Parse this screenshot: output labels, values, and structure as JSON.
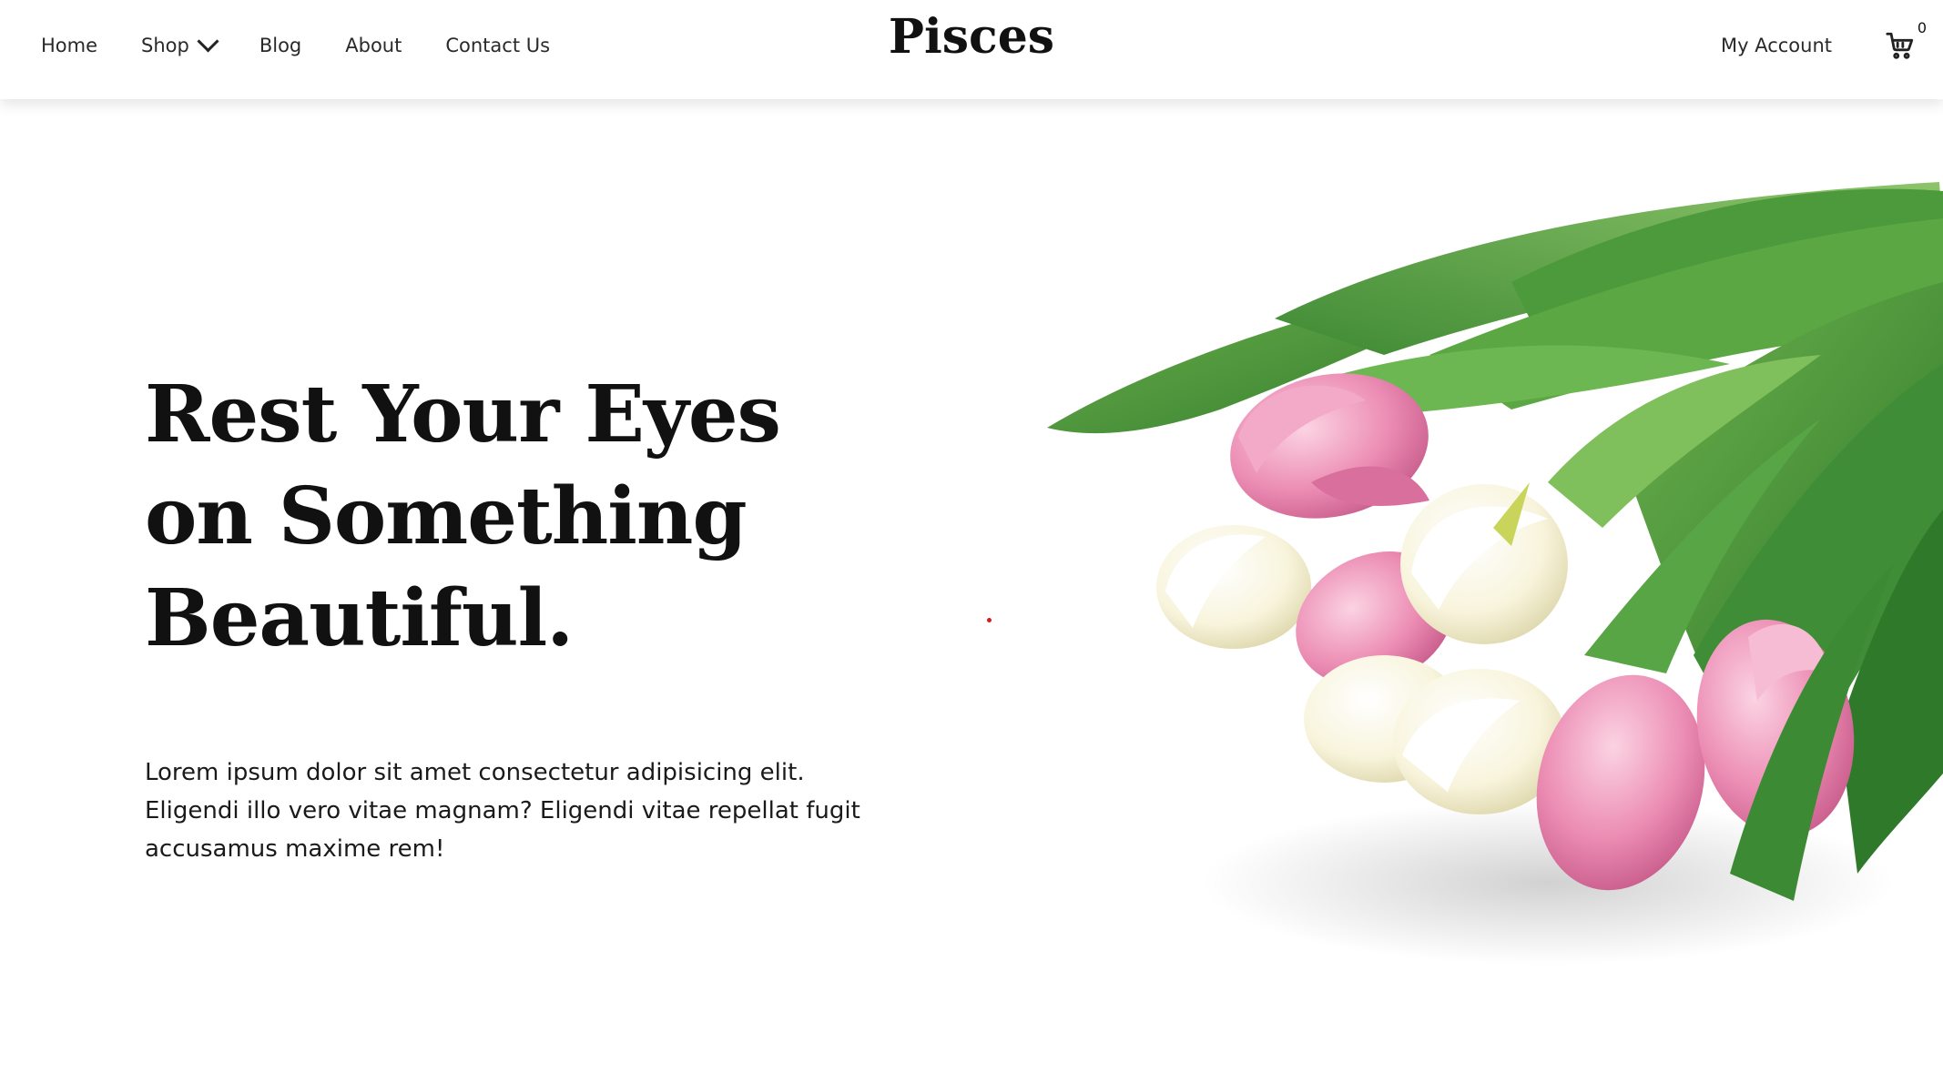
{
  "header": {
    "nav": [
      {
        "label": "Home"
      },
      {
        "label": "Shop"
      },
      {
        "label": "Blog"
      },
      {
        "label": "About"
      },
      {
        "label": "Contact Us"
      }
    ],
    "brand": "Pisces",
    "account_label": "My Account",
    "cart_count": "0"
  },
  "hero": {
    "headline_line1": "Rest Your Eyes",
    "headline_line2": "on Something",
    "headline_line3": "Beautiful.",
    "body": "Lorem ipsum dolor sit amet consectetur adipisicing elit. Eligendi illo vero vitae magnam? Eligendi vitae repellat fugit accusamus maxime rem!"
  },
  "colors": {
    "background": "#ffffff",
    "text": "#111111",
    "accent_dot": "#d0201f",
    "tulip_pink": "#e98bb1",
    "tulip_cream": "#f8f4dc",
    "leaf_green": "#4f9a3a"
  },
  "icons": {
    "shop_dropdown": "chevron-down-icon",
    "cart": "cart-icon"
  }
}
